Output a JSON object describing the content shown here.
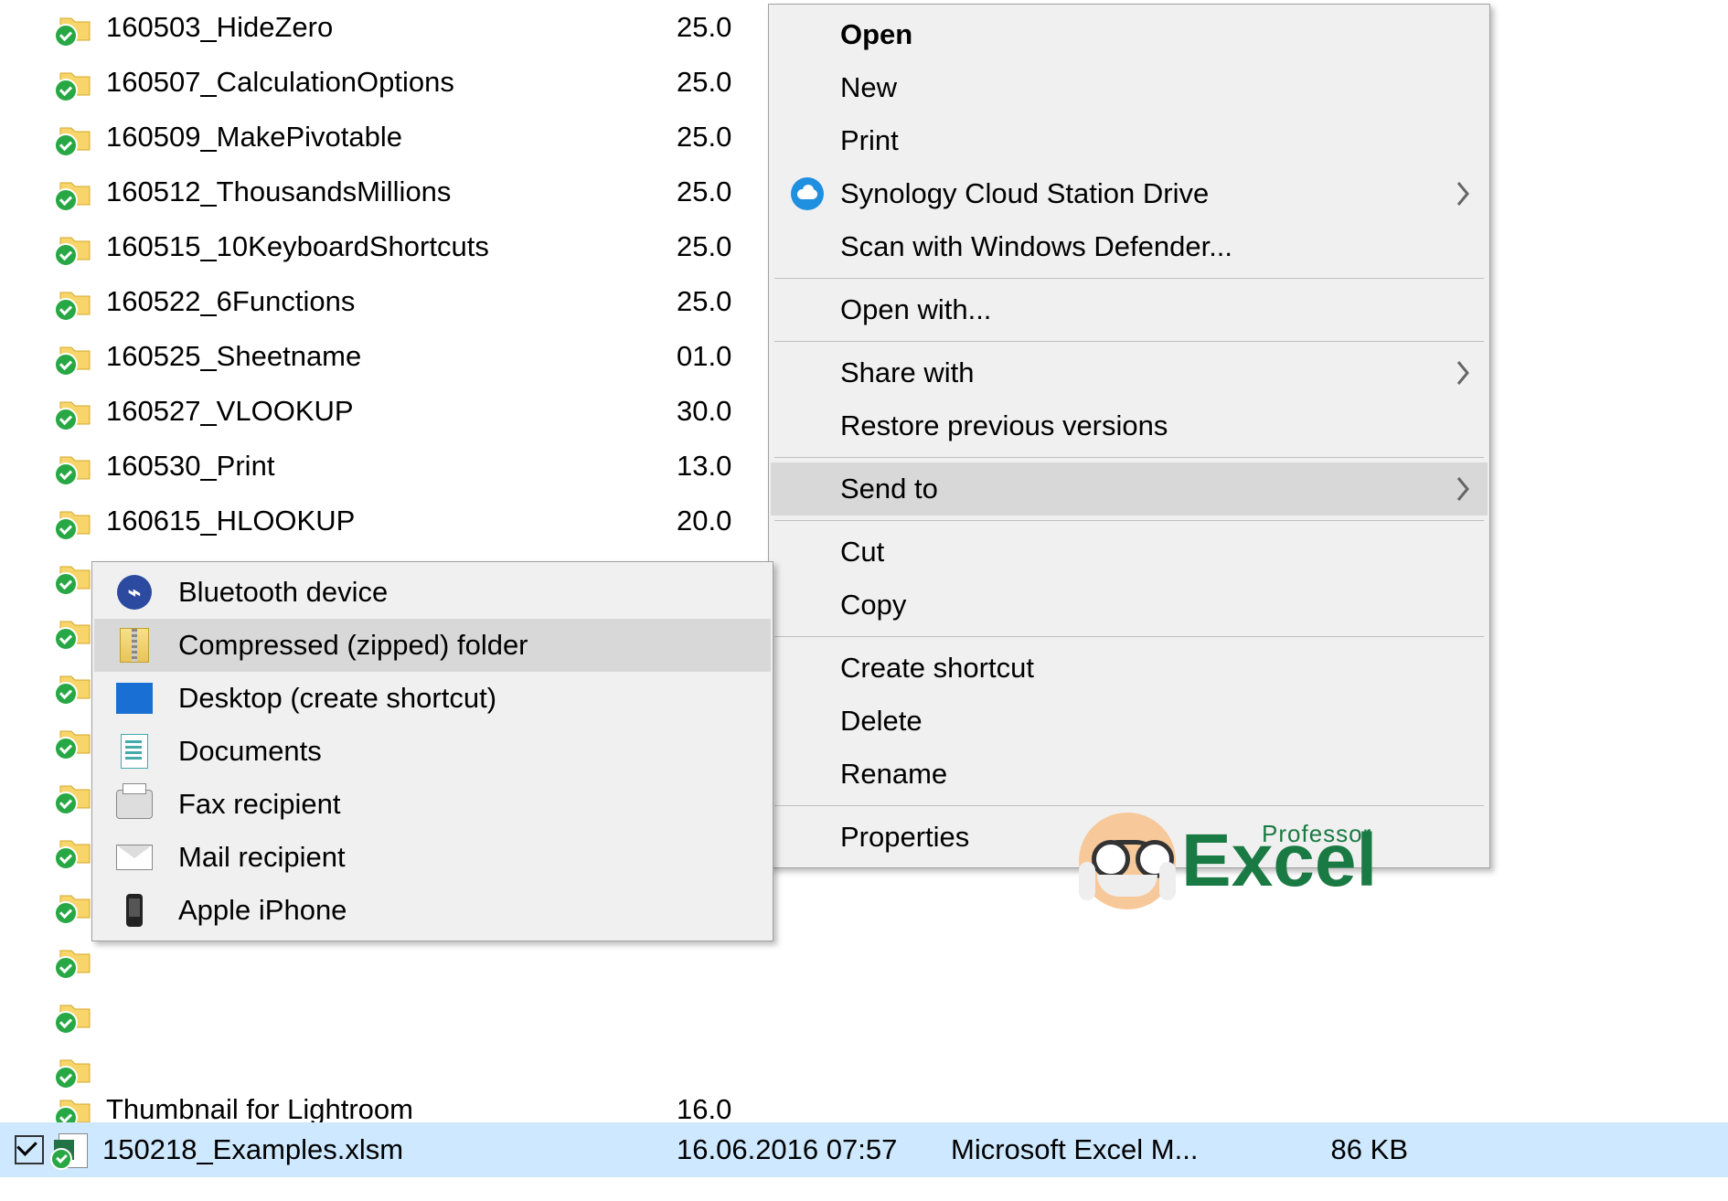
{
  "files": [
    {
      "name": "160503_HideZero",
      "date": "25.0"
    },
    {
      "name": "160507_CalculationOptions",
      "date": "25.0"
    },
    {
      "name": "160509_MakePivotable",
      "date": "25.0"
    },
    {
      "name": "160512_ThousandsMillions",
      "date": "25.0"
    },
    {
      "name": "160515_10KeyboardShortcuts",
      "date": "25.0"
    },
    {
      "name": "160522_6Functions",
      "date": "25.0"
    },
    {
      "name": "160525_Sheetname",
      "date": "01.0"
    },
    {
      "name": "160527_VLOOKUP",
      "date": "30.0"
    },
    {
      "name": "160530_Print",
      "date": "13.0"
    },
    {
      "name": "160615_HLOOKUP",
      "date": "20.0"
    }
  ],
  "obscured_tail": "Thumbnail for Lightroom",
  "obscured_date_tail": "16.0",
  "selected_file": {
    "name": "150218_Examples.xlsm",
    "date": "16.06.2016 07:57",
    "type": "Microsoft Excel M...",
    "size": "86 KB"
  },
  "context_menu": {
    "open": "Open",
    "new": "New",
    "print": "Print",
    "synology": "Synology Cloud Station Drive",
    "defender": "Scan with Windows Defender...",
    "open_with": "Open with...",
    "share": "Share with",
    "restore": "Restore previous versions",
    "send_to": "Send to",
    "cut": "Cut",
    "copy": "Copy",
    "shortcut": "Create shortcut",
    "delete": "Delete",
    "rename": "Rename",
    "properties": "Properties"
  },
  "send_to_menu": {
    "bluetooth": "Bluetooth device",
    "zip": "Compressed (zipped) folder",
    "desktop": "Desktop (create shortcut)",
    "documents": "Documents",
    "fax": "Fax recipient",
    "mail": "Mail recipient",
    "iphone": "Apple iPhone"
  },
  "logo": {
    "sup": "Professor",
    "main": "Excel"
  }
}
